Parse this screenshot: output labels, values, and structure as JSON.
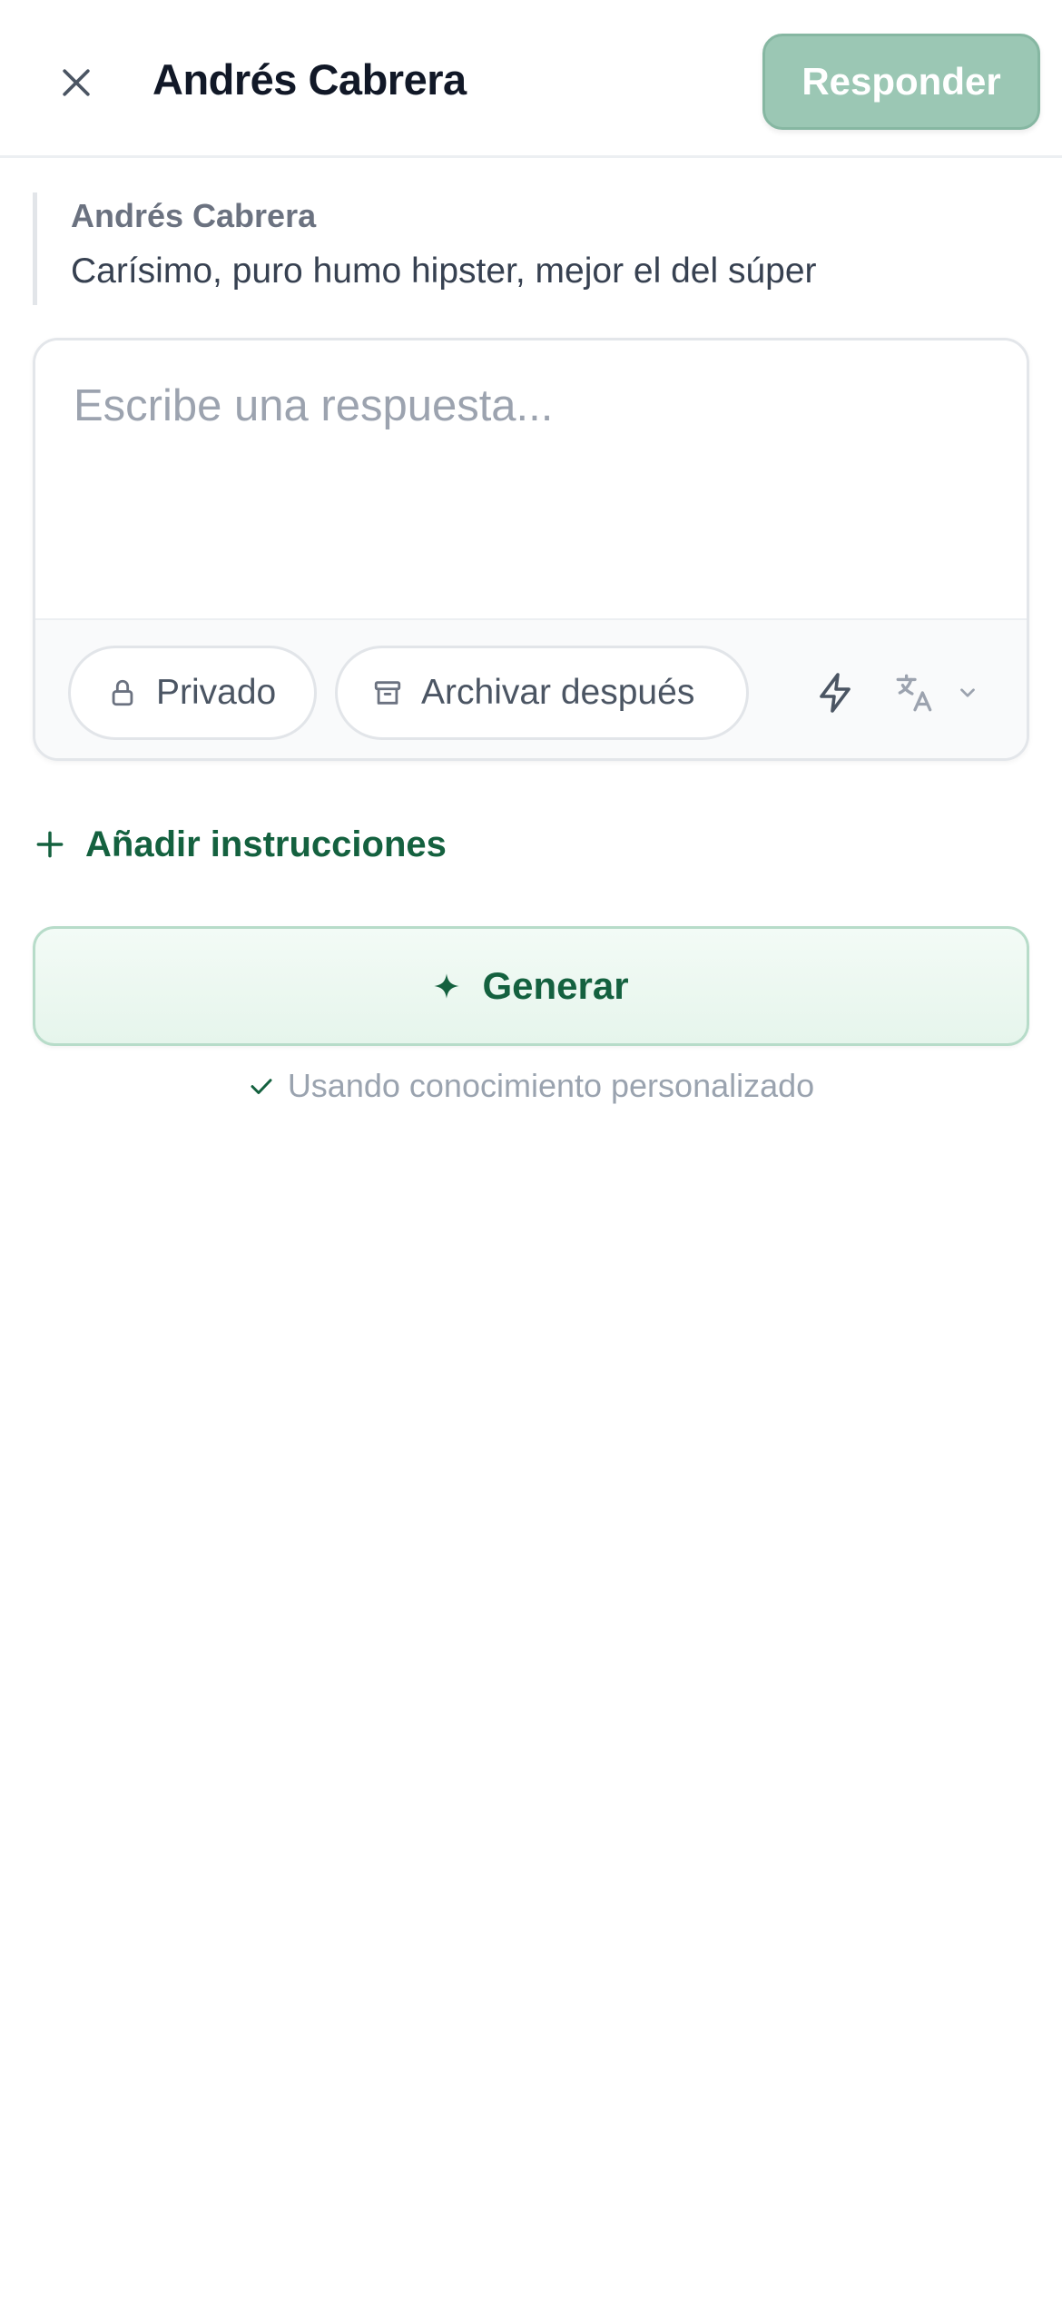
{
  "header": {
    "title": "Andrés Cabrera",
    "reply_label": "Responder",
    "close_icon": "close-icon"
  },
  "quote": {
    "author": "Andrés Cabrera",
    "text": "Carísimo, puro humo hipster, mejor el del súper"
  },
  "composer": {
    "value": "",
    "placeholder": "Escribe una respuesta...",
    "private_label": "Privado",
    "archive_label": "Archivar después",
    "icons": [
      "lock-icon",
      "archive-icon",
      "bolt-icon",
      "translate-icon",
      "chevron-down-icon"
    ]
  },
  "add_instructions_label": "Añadir instrucciones",
  "generate_label": "Generar",
  "knowledge_note": "Usando conocimiento personalizado",
  "colors": {
    "accent": "#14613f",
    "reply_button_bg": "#9bc7b4",
    "generate_bg": "#e9f6ee",
    "muted_text": "#9aa3af"
  }
}
